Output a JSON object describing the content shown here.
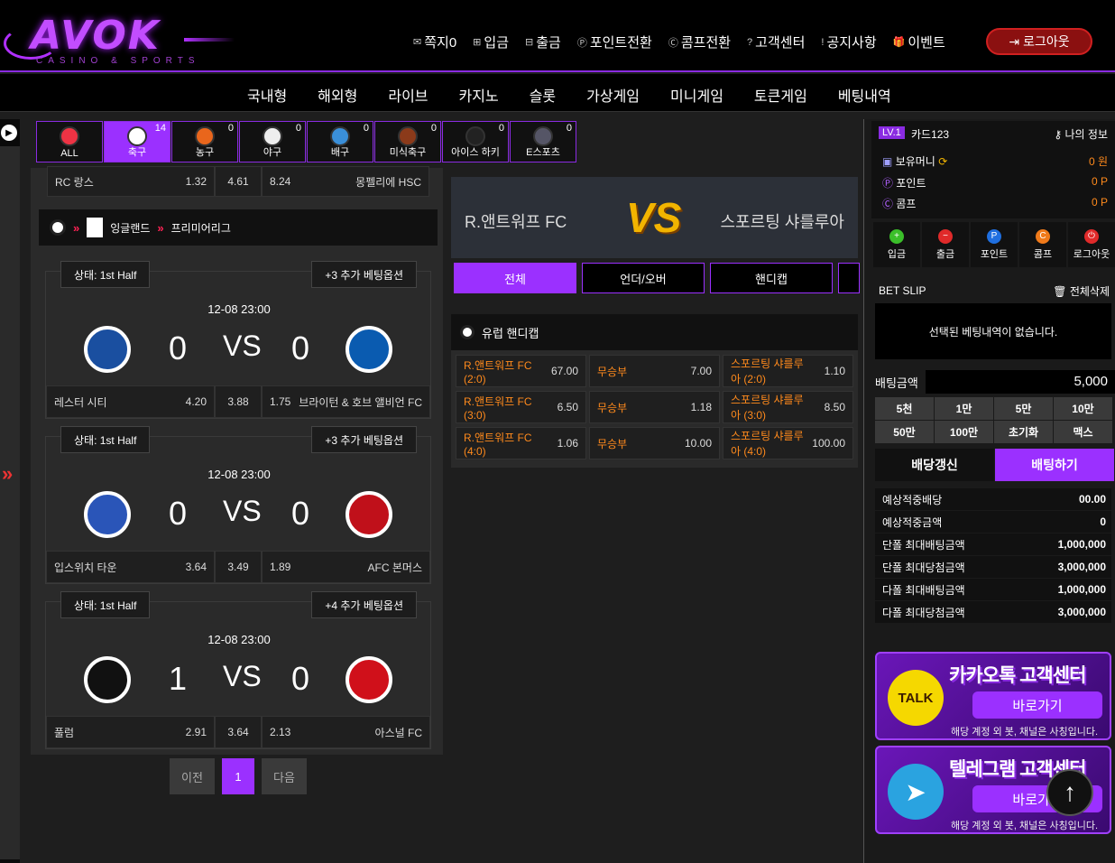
{
  "brand": {
    "name": "AVOK",
    "tagline": "CASINO & SPORTS"
  },
  "topnav": [
    {
      "icon": "mail-icon",
      "glyph": "✉",
      "label": "쪽지0"
    },
    {
      "icon": "plus-square-icon",
      "glyph": "⊞",
      "label": "입금"
    },
    {
      "icon": "minus-square-icon",
      "glyph": "⊟",
      "label": "출금"
    },
    {
      "icon": "point-icon",
      "glyph": "Ⓟ",
      "label": "포인트전환"
    },
    {
      "icon": "comp-icon",
      "glyph": "Ⓒ",
      "label": "콤프전환"
    },
    {
      "icon": "question-icon",
      "glyph": "?",
      "label": "고객센터"
    },
    {
      "icon": "info-icon",
      "glyph": "!",
      "label": "공지사항"
    },
    {
      "icon": "gift-icon",
      "glyph": "🎁",
      "label": "이벤트"
    }
  ],
  "logout_label": "로그아웃",
  "mainnav": [
    "국내형",
    "해외형",
    "라이브",
    "카지노",
    "슬롯",
    "가상게임",
    "미니게임",
    "토큰게임",
    "베팅내역"
  ],
  "sports": [
    {
      "label": "ALL",
      "count": "",
      "color": "#e34"
    },
    {
      "label": "축구",
      "count": "14",
      "color": "#fff"
    },
    {
      "label": "농구",
      "count": "0",
      "color": "#e9661c"
    },
    {
      "label": "야구",
      "count": "0",
      "color": "#eee"
    },
    {
      "label": "배구",
      "count": "0",
      "color": "#3a8fd9"
    },
    {
      "label": "미식축구",
      "count": "0",
      "color": "#8b3a1a"
    },
    {
      "label": "아이스 하키",
      "count": "0",
      "color": "#222"
    },
    {
      "label": "E스포츠",
      "count": "0",
      "color": "#556"
    }
  ],
  "prev_row": {
    "team1": "RC 랑스",
    "o1": "1.32",
    "draw": "4.61",
    "o2": "8.24",
    "team2": "몽펠리에 HSC"
  },
  "league": {
    "country": "잉글랜드",
    "name": "프리미어리그"
  },
  "matches": [
    {
      "state": "상태: 1st Half",
      "extra": "+3  추가 베팅옵션",
      "time": "12-08 23:00",
      "score1": "0",
      "vs": "VS",
      "score2": "0",
      "team1": "레스터 시티",
      "o1": "4.20",
      "draw": "3.88",
      "o2": "1.75",
      "team2": "브라이턴 & 호브 앨비언 FC",
      "c1": "#1a4fa0",
      "c2": "#0a5bb0"
    },
    {
      "state": "상태: 1st Half",
      "extra": "+3  추가 베팅옵션",
      "time": "12-08 23:00",
      "score1": "0",
      "vs": "VS",
      "score2": "0",
      "team1": "입스위치 타운",
      "o1": "3.64",
      "draw": "3.49",
      "o2": "1.89",
      "team2": "AFC 본머스",
      "c1": "#2a55b8",
      "c2": "#c0101a"
    },
    {
      "state": "상태: 1st Half",
      "extra": "+4  추가 베팅옵션",
      "time": "12-08 23:00",
      "score1": "1",
      "vs": "VS",
      "score2": "0",
      "team1": "풀럼",
      "o1": "2.91",
      "draw": "3.64",
      "o2": "2.13",
      "team2": "아스널 FC",
      "c1": "#111",
      "c2": "#d0101a"
    }
  ],
  "pager": {
    "prev": "이전",
    "page": "1",
    "next": "다음"
  },
  "detail": {
    "team1": "R.앤트워프 FC",
    "vs": "VS",
    "team2": "스포르팅 샤를루아",
    "tabs": [
      "전체",
      "언더/오버",
      "핸디캡"
    ],
    "market_title": "유럽 핸디캡",
    "rows": [
      {
        "home": "R.앤트워프 FC (2:0)",
        "ho": "67.00",
        "draw": "무승부",
        "do": "7.00",
        "away": "스포르팅 샤를루아 (2:0)",
        "ao": "1.10"
      },
      {
        "home": "R.앤트워프 FC (3:0)",
        "ho": "6.50",
        "draw": "무승부",
        "do": "1.18",
        "away": "스포르팅 샤를루아 (3:0)",
        "ao": "8.50"
      },
      {
        "home": "R.앤트워프 FC (4:0)",
        "ho": "1.06",
        "draw": "무승부",
        "do": "10.00",
        "away": "스포르팅 샤를루아 (4:0)",
        "ao": "100.00"
      }
    ]
  },
  "account": {
    "level": "LV.1",
    "name": "카드123",
    "myinfo": "나의  정보",
    "rows": [
      {
        "label": "보유머니",
        "value": "0 원"
      },
      {
        "label": "포인트",
        "value": "0 P"
      },
      {
        "label": "콤프",
        "value": "0 P"
      }
    ]
  },
  "quick": [
    {
      "label": "입금",
      "color": "#3bbf2a",
      "glyph": "+"
    },
    {
      "label": "출금",
      "color": "#e02a2a",
      "glyph": "−"
    },
    {
      "label": "포인트",
      "color": "#1f6fe0",
      "glyph": "P"
    },
    {
      "label": "콤프",
      "color": "#f07a1a",
      "glyph": "C"
    },
    {
      "label": "로그아웃",
      "color": "#e02a2a",
      "glyph": "⏻"
    }
  ],
  "slip": {
    "title": "BET SLIP",
    "clear": "전체삭제",
    "empty": "선택된 베팅내역이 없습니다."
  },
  "bet_amount": {
    "label": "배팅금액",
    "value": "5,000"
  },
  "chips": [
    "5천",
    "1만",
    "5만",
    "10만",
    "50만",
    "100만",
    "초기화",
    "맥스"
  ],
  "actions": {
    "refresh": "배당갱신",
    "bet": "배팅하기"
  },
  "expect": [
    {
      "label": "예상적중배당",
      "value": "00.00"
    },
    {
      "label": "예상적중금액",
      "value": "0"
    },
    {
      "label": "단폴 최대배팅금액",
      "value": "1,000,000"
    },
    {
      "label": "단폴 최대당첨금액",
      "value": "3,000,000"
    },
    {
      "label": "다폴 최대배팅금액",
      "value": "1,000,000"
    },
    {
      "label": "다폴 최대당첨금액",
      "value": "3,000,000"
    }
  ],
  "banners": [
    {
      "title": "카카오톡 고객센터",
      "go": "바로가기",
      "note": "해당 계정 외 봇, 채널은 사칭입니다.",
      "badge": "TALK"
    },
    {
      "title": "텔레그램 고객센터",
      "go": "바로가기",
      "note": "해당 계정 외 봇, 채널은 사칭입니다.",
      "badge": ""
    }
  ]
}
